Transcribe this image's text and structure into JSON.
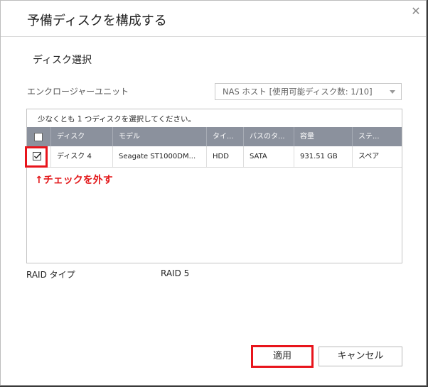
{
  "dialog": {
    "title": "予備ディスクを構成する",
    "close_glyph": "✕"
  },
  "section_title": "ディスク選択",
  "enclosure": {
    "label": "エンクロージャーユニット",
    "selected": "NAS ホスト [使用可能ディスク数: 1/10]"
  },
  "table": {
    "instruction": "少なくとも 1 つディスクを選択してください。",
    "columns": [
      "ディスク",
      "モデル",
      "タイ...",
      "バスのタ...",
      "容量",
      "ステ..."
    ],
    "rows": [
      {
        "checked": true,
        "disk": "ディスク 4",
        "model": "Seagate ST1000DM...",
        "type": "HDD",
        "bus": "SATA",
        "capacity": "931.51 GB",
        "status": "スペア"
      }
    ]
  },
  "annotation": "↑チェックを外す",
  "raid": {
    "label": "RAID タイプ",
    "value": "RAID 5"
  },
  "buttons": {
    "apply": "適用",
    "cancel": "キャンセル"
  },
  "colors": {
    "header_bg": "#8b919d",
    "highlight_red": "#e8141b"
  }
}
